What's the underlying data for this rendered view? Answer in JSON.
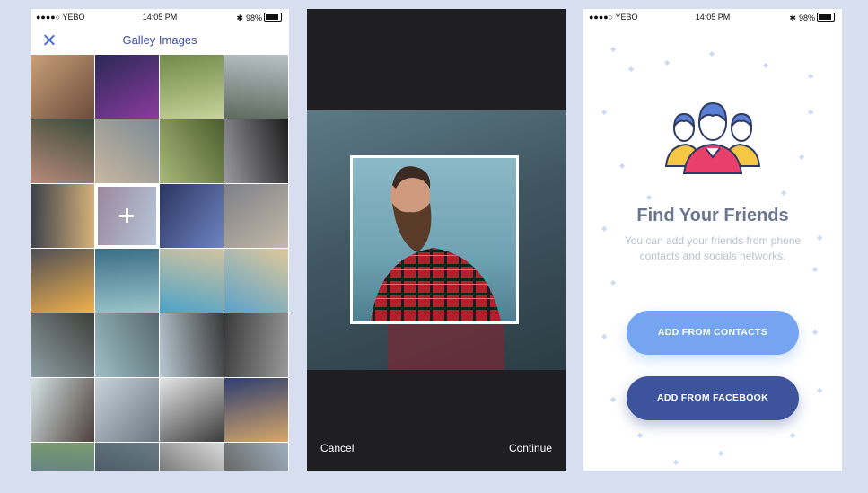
{
  "status_bar": {
    "carrier": "●●●●○ YEBO",
    "time": "14:05 PM",
    "battery": "98%"
  },
  "gallery": {
    "title": "Galley Images",
    "tiles": [
      {
        "colors": [
          "#c9a17a",
          "#6b4b3a"
        ]
      },
      {
        "colors": [
          "#2a2855",
          "#8a3b9e"
        ]
      },
      {
        "colors": [
          "#6f8a4a",
          "#c7d39a"
        ]
      },
      {
        "colors": [
          "#b9c2c7",
          "#5d6a5e"
        ]
      },
      {
        "colors": [
          "#3b4b3a",
          "#b88a7a"
        ]
      },
      {
        "colors": [
          "#7c8b94",
          "#c9b7a1"
        ]
      },
      {
        "colors": [
          "#4b5e2d",
          "#a9b97b"
        ]
      },
      {
        "colors": [
          "#1c1c1c",
          "#9a9aa0"
        ]
      },
      {
        "colors": [
          "#d8b27a",
          "#394049"
        ]
      },
      {
        "colors": [
          "#9fb7cf",
          "#7a5c7a"
        ],
        "selected": true
      },
      {
        "colors": [
          "#6f84c2",
          "#2a3560"
        ]
      },
      {
        "colors": [
          "#c5b9a8",
          "#7d8088"
        ]
      },
      {
        "colors": [
          "#f2b14d",
          "#4b4d55"
        ]
      },
      {
        "colors": [
          "#9bc4cb",
          "#3a6e86"
        ]
      },
      {
        "colors": [
          "#4da3c7",
          "#d2c4a0"
        ]
      },
      {
        "colors": [
          "#5aa2cc",
          "#e0c99a"
        ]
      },
      {
        "colors": [
          "#8d9fa4",
          "#3e3f3a"
        ]
      },
      {
        "colors": [
          "#9fbfc5",
          "#556a70"
        ]
      },
      {
        "colors": [
          "#b9c9d3",
          "#3a3a3a"
        ]
      },
      {
        "colors": [
          "#3a3a3a",
          "#9a9a9a"
        ]
      },
      {
        "colors": [
          "#d6e5e6",
          "#4c3f39"
        ]
      },
      {
        "colors": [
          "#c9d3db",
          "#6b7681"
        ]
      },
      {
        "colors": [
          "#e6e6e6",
          "#3b3b3b"
        ]
      },
      {
        "colors": [
          "#2c3e70",
          "#d8a86a"
        ]
      },
      {
        "colors": [
          "#7b9a6e",
          "#4d6e9a"
        ]
      },
      {
        "colors": [
          "#6b7c86",
          "#394653"
        ]
      },
      {
        "colors": [
          "#dadada",
          "#4f4f4f"
        ]
      },
      {
        "colors": [
          "#9fb0c0",
          "#57524b"
        ]
      }
    ]
  },
  "crop": {
    "cancel_label": "Cancel",
    "continue_label": "Continue"
  },
  "friends": {
    "title": "Find Your Friends",
    "description": "You can add your friends from phone contacts and socials networks.",
    "contacts_button": "ADD FROM CONTACTS",
    "facebook_button": "ADD FROM FACEBOOK",
    "icon": "friends-group-icon"
  },
  "colors": {
    "accent": "#3c4ea7",
    "contacts": "#75a5f1",
    "facebook": "#3d539c"
  }
}
